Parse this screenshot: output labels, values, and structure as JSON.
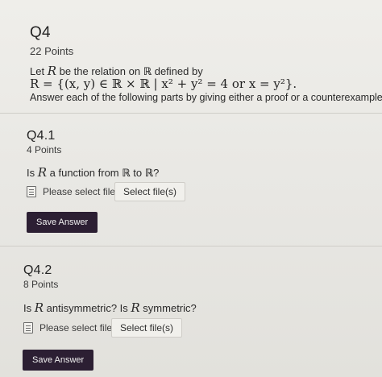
{
  "q4": {
    "title": "Q4",
    "points": "22 Points",
    "intro_pre": "Let ",
    "intro_var": "R",
    "intro_mid": " be the relation on ",
    "intro_set": "ℝ",
    "intro_post": " defined by",
    "definition": "R = {(x, y) ∈ ℝ × ℝ | x² + y² = 4  or  x = y²}.",
    "instruction": "Answer each of the following parts by giving either a proof or a counterexample."
  },
  "q41": {
    "title": "Q4.1",
    "points": "4 Points",
    "question_pre": "Is ",
    "question_var": "R",
    "question_mid": " a function from ",
    "question_set1": "ℝ",
    "question_to": " to ",
    "question_set2": "ℝ",
    "question_end": "?",
    "upload_label": "Please select file(s)",
    "select_button": "Select file(s)",
    "save_button": "Save Answer"
  },
  "q42": {
    "title": "Q4.2",
    "points": "8 Points",
    "question_pre": "Is ",
    "question_var1": "R",
    "question_mid": " antisymmetric? Is ",
    "question_var2": "R",
    "question_end": " symmetric?",
    "upload_label": "Please select file(s)",
    "select_button": "Select file(s)",
    "save_button": "Save Answer"
  },
  "icons": {
    "upload": "file-upload-icon"
  },
  "colors": {
    "background": "#e9e8e4",
    "save_button_bg": "#2c1f33",
    "save_button_text": "#f2f2f2",
    "select_button_bg": "#f1f0ec"
  }
}
